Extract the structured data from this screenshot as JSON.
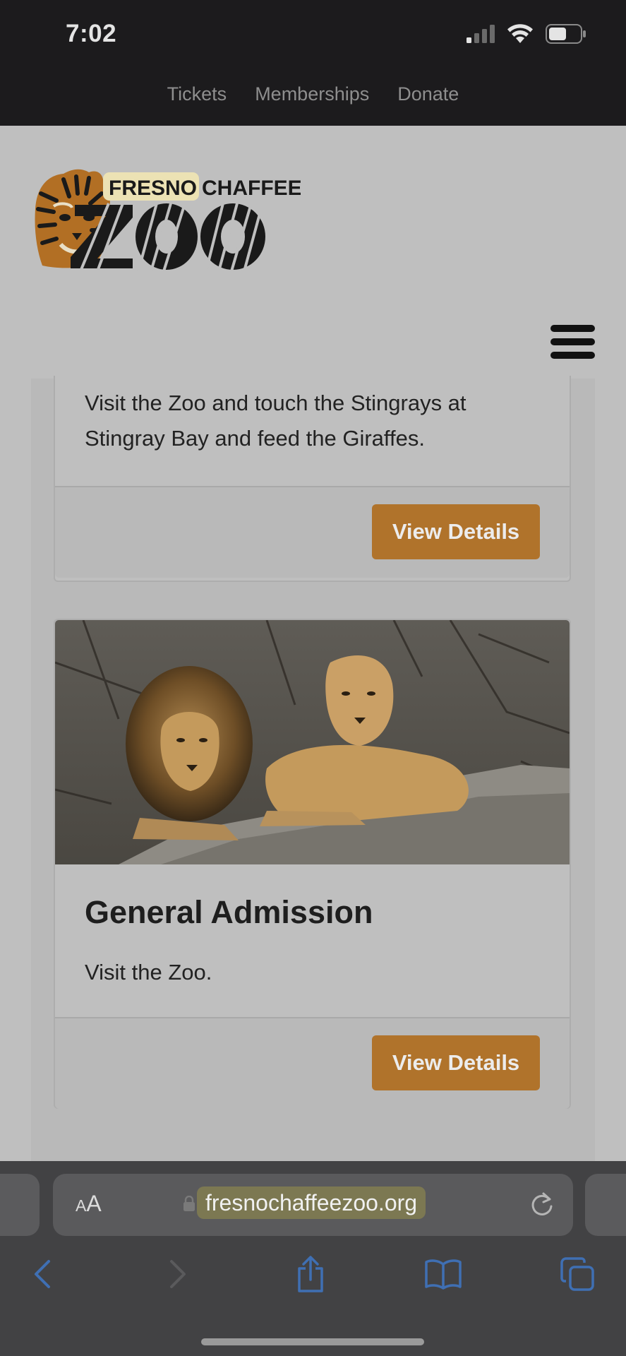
{
  "status_bar": {
    "time": "7:02"
  },
  "top_nav": {
    "items": [
      "Tickets",
      "Memberships",
      "Donate"
    ]
  },
  "logo": {
    "line1_highlight": "FRESNO",
    "line1_rest": "CHAFFEE",
    "line2": "ZOO"
  },
  "cards": [
    {
      "text": "Visit the Zoo and touch the Stingrays at Stingray Bay and feed the Giraffes.",
      "button": "View Details"
    },
    {
      "title": "General Admission",
      "text": "Visit the Zoo.",
      "button": "View Details",
      "image": "lion-and-lioness-photo"
    }
  ],
  "browser": {
    "aa_label": "AA",
    "url": "fresnochaffeezoo.org"
  },
  "colors": {
    "accent_button": "#b0732b",
    "topbar_bg": "#1c1b1d",
    "page_bg": "#bfbfbf",
    "url_highlight": "#7c7852",
    "toolbar_icon": "#3f6fb3"
  },
  "icons": [
    "cellular-signal-icon",
    "wifi-icon",
    "battery-icon",
    "hamburger-menu-icon",
    "lock-icon",
    "reload-icon",
    "back-icon",
    "forward-icon",
    "share-icon",
    "bookmarks-icon",
    "tabs-icon"
  ]
}
